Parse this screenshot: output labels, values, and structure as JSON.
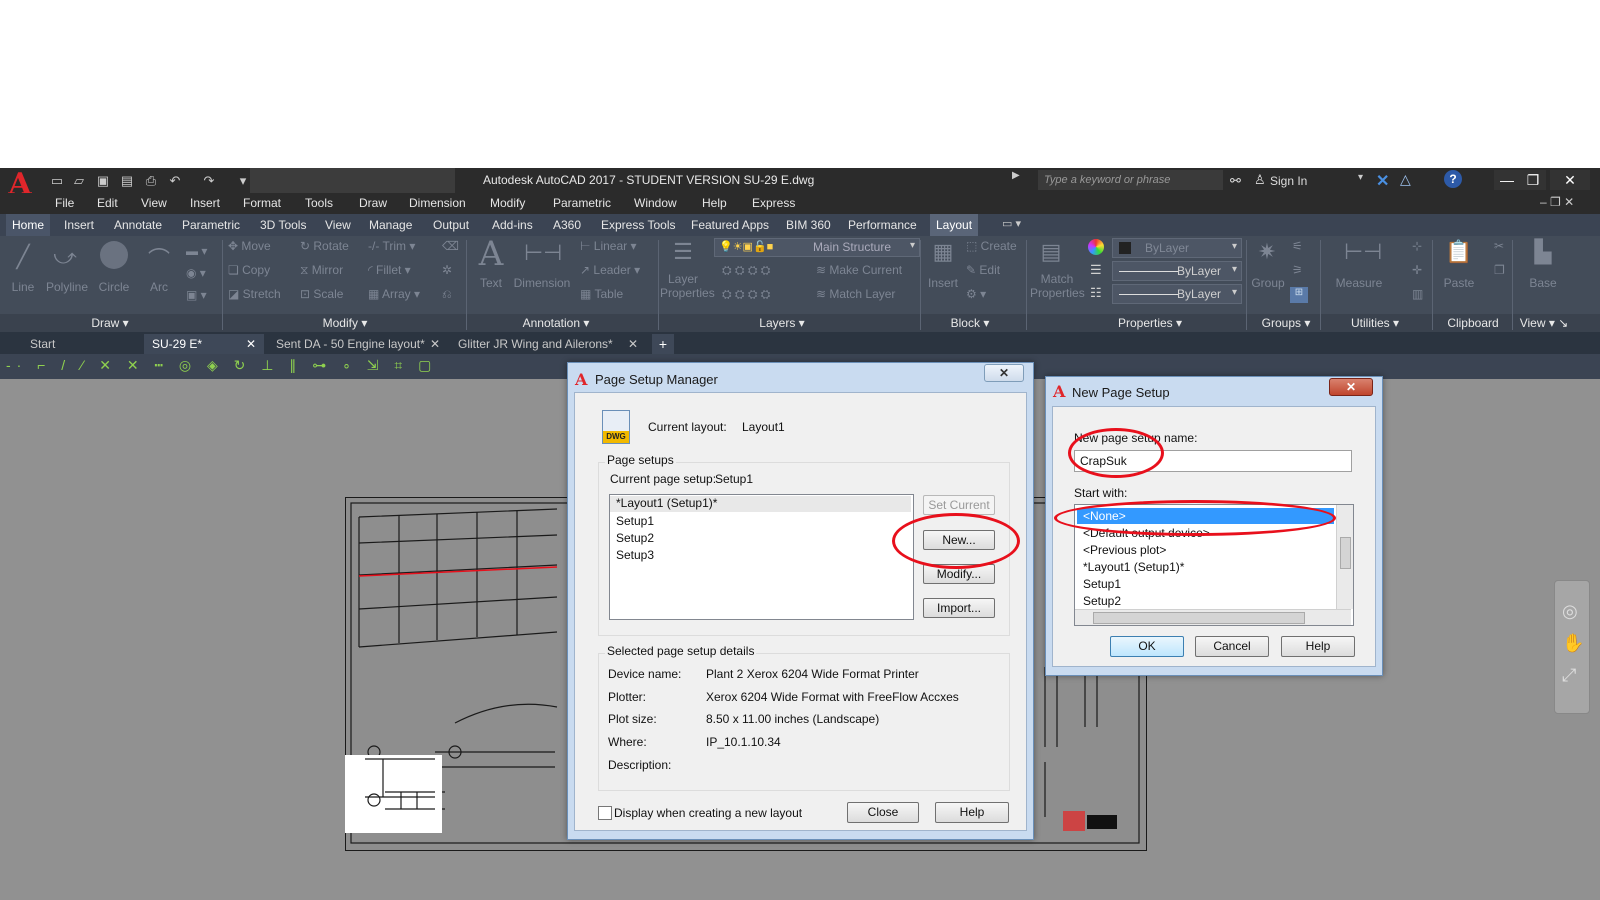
{
  "app": {
    "title": "Autodesk AutoCAD 2017 - STUDENT VERSION    SU-29 E.dwg",
    "search_placeholder": "Type a keyword or phrase",
    "sign_in": "Sign In",
    "logo_letter": "A"
  },
  "menubar": [
    "File",
    "Edit",
    "View",
    "Insert",
    "Format",
    "Tools",
    "Draw",
    "Dimension",
    "Modify",
    "Parametric",
    "Window",
    "Help",
    "Express"
  ],
  "ribbon_tabs": [
    "Home",
    "Insert",
    "Annotate",
    "Parametric",
    "3D Tools",
    "View",
    "Manage",
    "Output",
    "Add-ins",
    "A360",
    "Express Tools",
    "Featured Apps",
    "BIM 360",
    "Performance",
    "Layout"
  ],
  "ribbon": {
    "draw": {
      "line": "Line",
      "polyline": "Polyline",
      "circle": "Circle",
      "arc": "Arc",
      "panel": "Draw"
    },
    "modify": {
      "move": "Move",
      "rotate": "Rotate",
      "trim": "Trim",
      "copy": "Copy",
      "mirror": "Mirror",
      "fillet": "Fillet",
      "stretch": "Stretch",
      "scale": "Scale",
      "array": "Array",
      "panel": "Modify"
    },
    "annotation": {
      "text": "Text",
      "dimension": "Dimension",
      "linear": "Linear",
      "leader": "Leader",
      "table": "Table",
      "panel": "Annotation"
    },
    "layers": {
      "layer_properties_1": "Layer",
      "layer_properties_2": "Properties",
      "current_layer": "Main Structure",
      "make_current": "Make Current",
      "match_layer": "Match Layer",
      "panel": "Layers"
    },
    "block": {
      "insert": "Insert",
      "create": "Create",
      "edit": "Edit",
      "panel": "Block"
    },
    "properties": {
      "match_1": "Match",
      "match_2": "Properties",
      "bylayer_color": "ByLayer",
      "bylayer_line": "ByLayer",
      "bylayer_weight": "ByLayer",
      "panel": "Properties"
    },
    "groups": {
      "group": "Group",
      "panel": "Groups"
    },
    "utilities": {
      "measure": "Measure",
      "panel": "Utilities"
    },
    "clipboard": {
      "paste": "Paste",
      "panel": "Clipboard"
    },
    "view": {
      "base": "Base",
      "panel": "View"
    }
  },
  "doc_tabs": [
    "Start",
    "SU-29 E*",
    "Sent DA - 50 Engine layout*",
    "Glitter JR Wing and Ailerons*"
  ],
  "page_setup_manager": {
    "title": "Page Setup Manager",
    "current_layout_label": "Current layout:",
    "current_layout_value": "Layout1",
    "icon_text": "DWG",
    "page_setups_group": "Page setups",
    "current_page_setup_label": "Current page setup:",
    "current_page_setup_value": "Setup1",
    "setups": [
      "*Layout1 (Setup1)*",
      "Setup1",
      "Setup2",
      "Setup3"
    ],
    "buttons": {
      "set_current": "Set Current",
      "new": "New...",
      "modify": "Modify...",
      "import": "Import...",
      "close": "Close",
      "help": "Help"
    },
    "details_group": "Selected page setup details",
    "details": {
      "device_name_label": "Device name:",
      "device_name": "Plant 2 Xerox 6204 Wide Format Printer",
      "plotter_label": "Plotter:",
      "plotter": "Xerox 6204 Wide Format with FreeFlow Accxes",
      "plot_size_label": "Plot size:",
      "plot_size": "8.50 x 11.00 inches (Landscape)",
      "where_label": "Where:",
      "where": "IP_10.1.10.34",
      "description_label": "Description:"
    },
    "checkbox_label": "Display when creating a new layout"
  },
  "new_page_setup": {
    "title": "New Page Setup",
    "name_label": "New page setup name:",
    "name_value": "CrapSuk",
    "start_with_label": "Start with:",
    "options": [
      "<None>",
      "<Default output device>",
      "<Previous plot>",
      "*Layout1 (Setup1)*",
      "Setup1",
      "Setup2"
    ],
    "selected_index": 0,
    "buttons": {
      "ok": "OK",
      "cancel": "Cancel",
      "help": "Help"
    }
  },
  "colors": {
    "annotation_red": "#e8101c",
    "selection_blue": "#3399ff",
    "ribbon_bg": "#434c59",
    "title_bg": "#2b2b2b"
  }
}
